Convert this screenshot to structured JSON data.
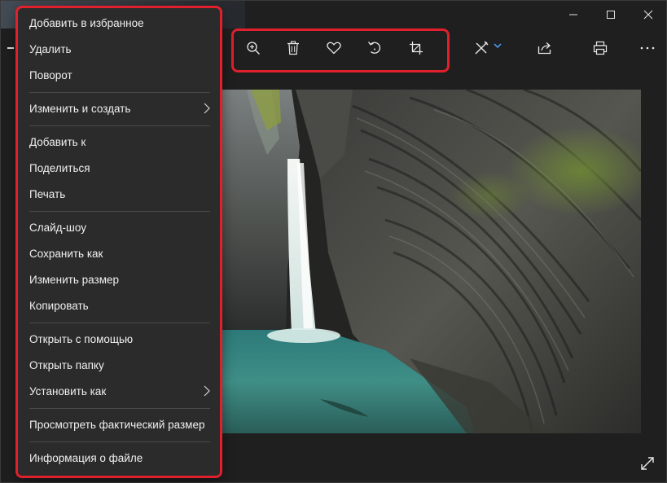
{
  "window": {
    "minimize_icon": "minimize-icon",
    "maximize_icon": "maximize-icon",
    "close_icon": "close-icon"
  },
  "toolbar": {
    "icons": [
      "zoom-in-icon",
      "delete-icon",
      "heart-icon",
      "rotate-icon",
      "crop-icon",
      "edit-icon",
      "share-icon",
      "print-icon",
      "more-icon"
    ]
  },
  "menu": {
    "items": [
      {
        "label": "Добавить в избранное"
      },
      {
        "label": "Удалить"
      },
      {
        "label": "Поворот"
      },
      {
        "label": "Изменить и создать"
      },
      {
        "label": "Добавить к"
      },
      {
        "label": "Поделиться"
      },
      {
        "label": "Печать"
      },
      {
        "label": "Слайд-шоу"
      },
      {
        "label": "Сохранить как"
      },
      {
        "label": "Изменить размер"
      },
      {
        "label": "Копировать"
      },
      {
        "label": "Открыть с помощью"
      },
      {
        "label": "Открыть папку"
      },
      {
        "label": "Установить как"
      },
      {
        "label": "Просмотреть фактический размер"
      },
      {
        "label": "Информация о файле"
      }
    ]
  },
  "colors": {
    "highlight_frame": "#e0202c",
    "menu_background": "#2b2b2b",
    "app_background": "#1f1f1f"
  }
}
